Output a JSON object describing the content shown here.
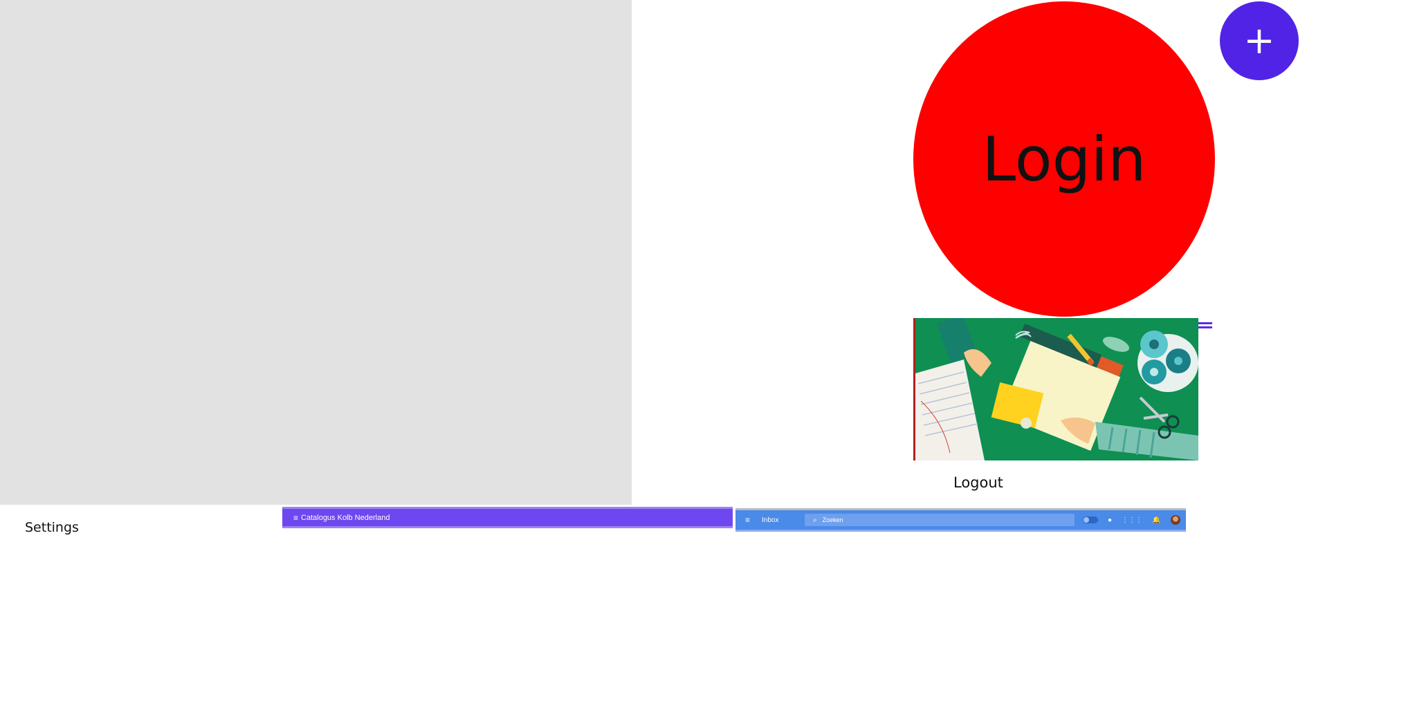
{
  "login": {
    "label": "Login"
  },
  "fab": {
    "label": "+"
  },
  "logout": {
    "label": "Logout"
  },
  "settings": {
    "label": "Settings"
  },
  "catalog_bar": {
    "menu_icon": "≡",
    "title": "Catalogus Kolb Nederland"
  },
  "inbox_bar": {
    "menu_icon": "≡",
    "title": "Inbox",
    "search_icon": "⌕",
    "search_placeholder": "Zoeken",
    "chat_icon": "●",
    "apps_icon": "⋮⋮⋮",
    "bell_icon": "🔔"
  },
  "colors": {
    "login_circle": "#ff0000",
    "fab": "#5123e6",
    "catalog_bar": "#6f47f0",
    "inbox_bar": "#4a8ae8",
    "gray_panel": "#e2e2e2"
  }
}
